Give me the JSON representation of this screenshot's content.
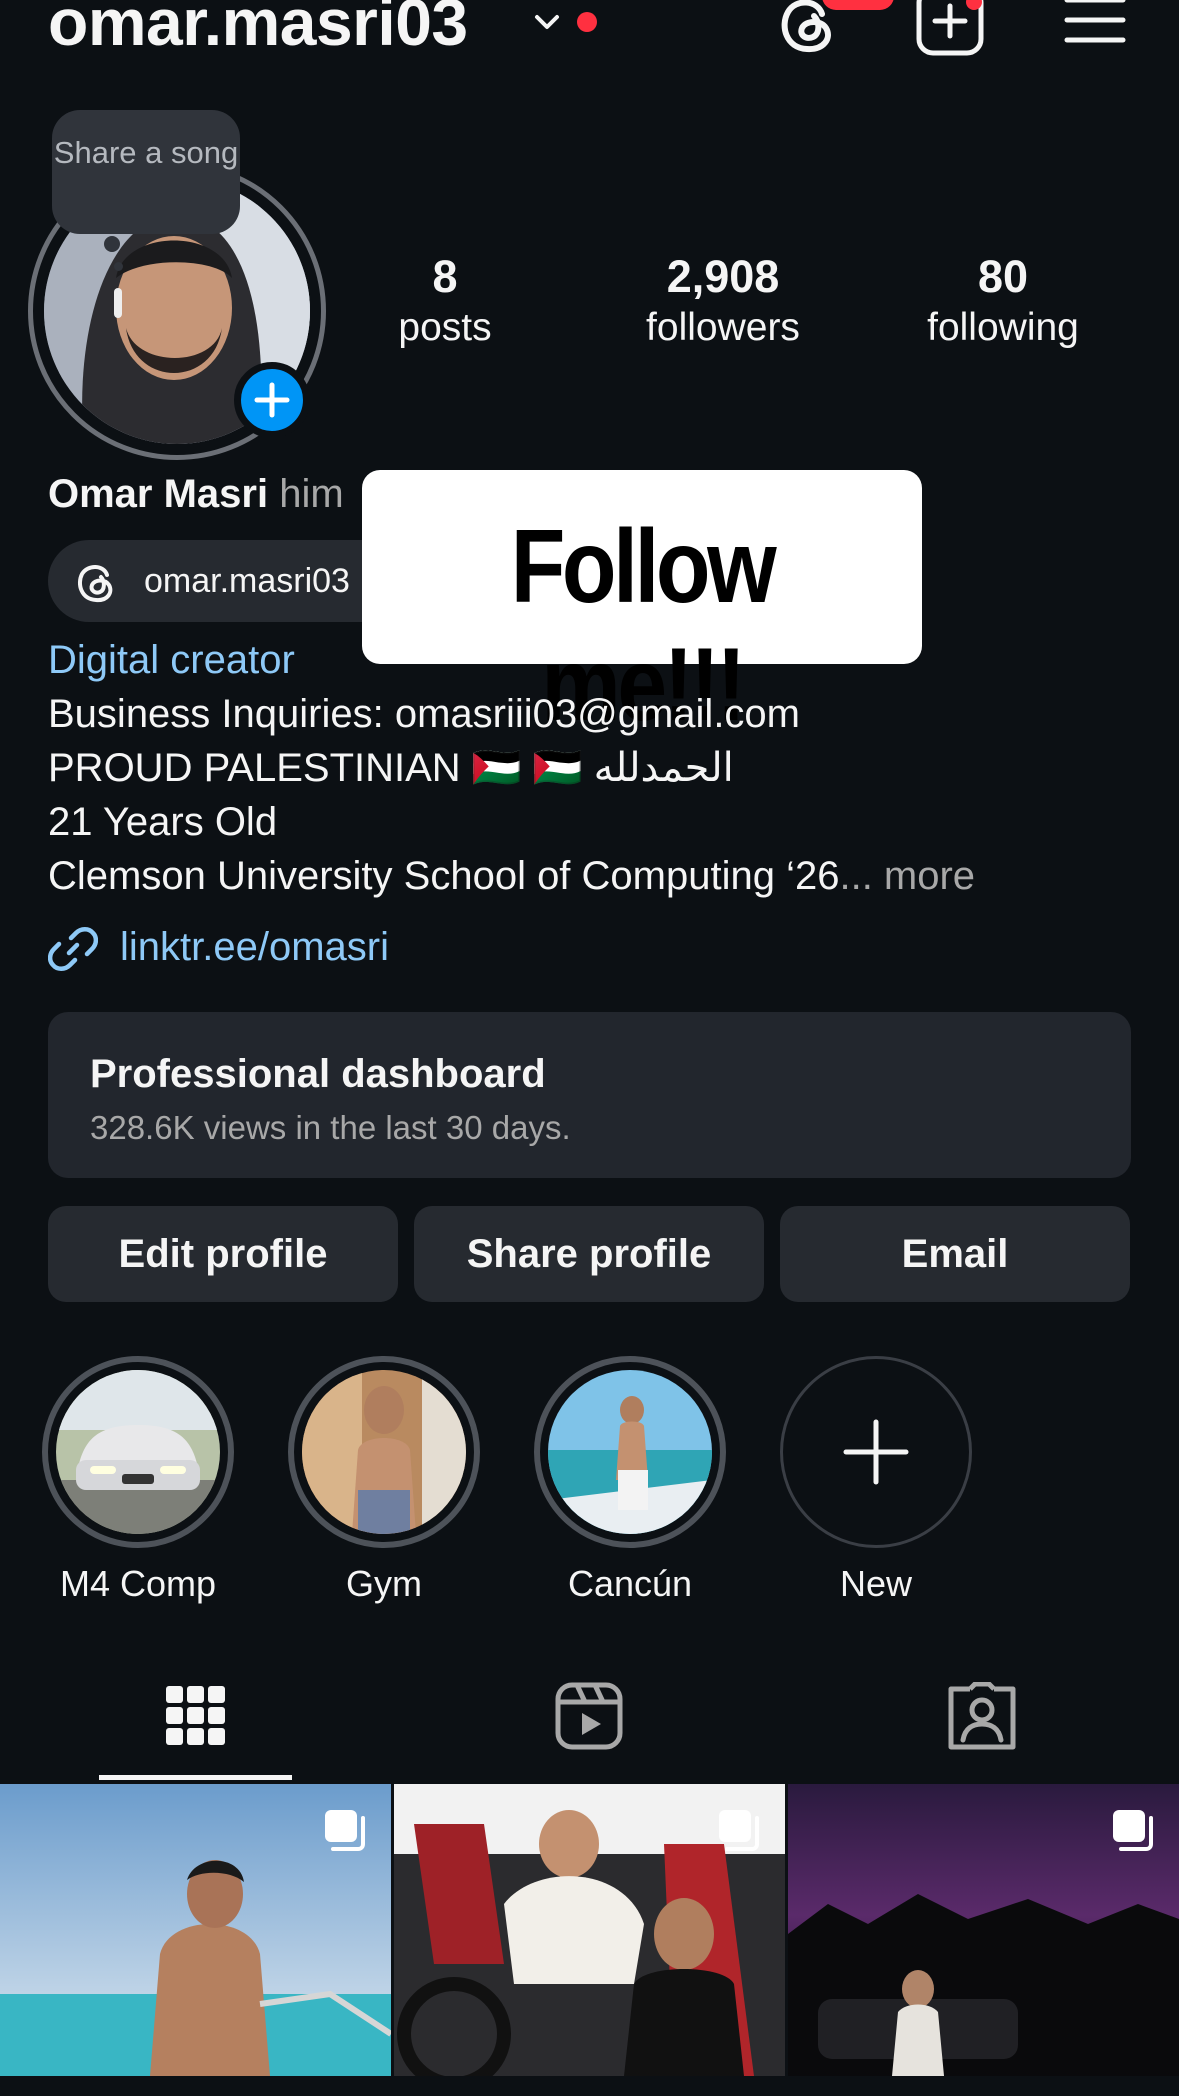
{
  "header": {
    "username": "omar.masri03",
    "icons": [
      "chevron-down-icon",
      "threads-icon",
      "new-post-icon",
      "menu-icon"
    ],
    "notification_color": "#ff3040"
  },
  "profile": {
    "song_bubble": "Share a song",
    "stats": [
      {
        "value": "8",
        "label": "posts"
      },
      {
        "value": "2,908",
        "label": "followers"
      },
      {
        "value": "80",
        "label": "following"
      }
    ],
    "name": "Omar Masri",
    "pronouns": "him",
    "threads_handle": "omar.masri03",
    "sticker_text": "Follow me!!!",
    "category": "Digital creator",
    "bio": [
      "Business Inquiries: omasriii03@gmail.com",
      "PROUD PALESTINIAN 🇵🇸 🇵🇸 الحمدلله",
      "21 Years Old",
      "Clemson University School of Computing ‘26"
    ],
    "more_label": "... more",
    "link": "linktr.ee/omasri"
  },
  "dashboard": {
    "title": "Professional dashboard",
    "subtitle": "328.6K views in the last 30 days."
  },
  "buttons": {
    "edit": "Edit profile",
    "share": "Share profile",
    "email": "Email"
  },
  "highlights": [
    {
      "label": "M4 Comp"
    },
    {
      "label": "Gym"
    },
    {
      "label": "Cancún"
    },
    {
      "label": "New"
    }
  ],
  "tabs": [
    "grid-icon",
    "reels-icon",
    "tagged-icon"
  ],
  "colors": {
    "background": "#0c1014",
    "link": "#8ec9f7",
    "accent_blue": "#0095f6",
    "muted": "#a8a8a8"
  }
}
